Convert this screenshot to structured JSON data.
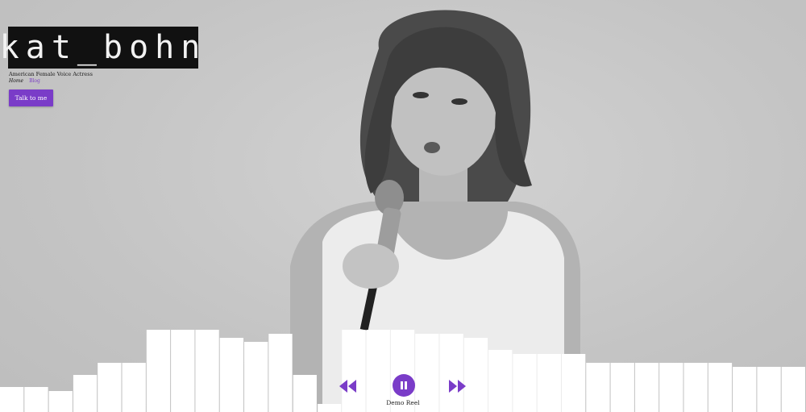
{
  "brand": {
    "logo": "kat_bohn",
    "tagline": "American Female Voice Actress"
  },
  "nav": {
    "home": "Home",
    "blog": "Blog"
  },
  "cta": {
    "talk": "Talk to me"
  },
  "player": {
    "track": "Demo Reel",
    "state": "playing",
    "rewind_icon": "rewind-icon",
    "pause_icon": "pause-icon",
    "forward_icon": "fast-forward-icon"
  },
  "colors": {
    "accent": "#7a3cc8",
    "logo_bg": "#111111",
    "background": "#c9c9c9",
    "bars": "#ffffff"
  },
  "equalizer_levels": [
    0.06,
    0.06,
    0.05,
    0.09,
    0.12,
    0.12,
    0.2,
    0.2,
    0.2,
    0.18,
    0.17,
    0.19,
    0.09,
    0.02,
    0.2,
    0.2,
    0.2,
    0.19,
    0.19,
    0.18,
    0.15,
    0.14,
    0.14,
    0.14,
    0.12,
    0.12,
    0.12,
    0.12,
    0.12,
    0.12,
    0.11,
    0.11,
    0.11
  ]
}
